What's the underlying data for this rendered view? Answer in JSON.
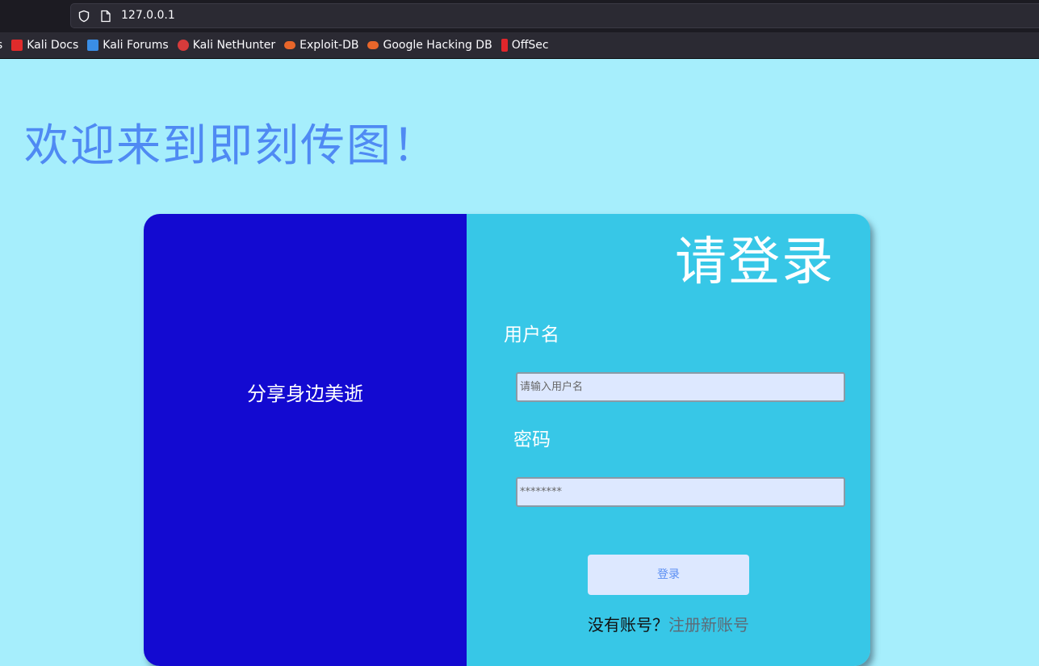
{
  "browser": {
    "url": "127.0.0.1",
    "bookmarks": [
      {
        "label": "ls",
        "icon": "truncated-bookmark",
        "color": ""
      },
      {
        "label": "Kali Docs",
        "icon": "kali-docs-icon",
        "color": "#e02b2b"
      },
      {
        "label": "Kali Forums",
        "icon": "kali-forums-icon",
        "color": "#3a8ee6"
      },
      {
        "label": "Kali NetHunter",
        "icon": "kali-nethunter-icon",
        "color": "#d63b3b"
      },
      {
        "label": "Exploit-DB",
        "icon": "exploit-db-icon",
        "color": "#e8662a"
      },
      {
        "label": "Google Hacking DB",
        "icon": "ghdb-icon",
        "color": "#e8662a"
      },
      {
        "label": "OffSec",
        "icon": "offsec-icon",
        "color": "#e0262b"
      }
    ]
  },
  "page": {
    "welcome": "欢迎来到即刻传图！",
    "slogan": "分享身边美逝",
    "login_title": "请登录",
    "username_label": "用户名",
    "username_placeholder": "请输入用户名",
    "password_label": "密码",
    "password_placeholder": "********",
    "submit_label": "登录",
    "no_account_text": "没有账号？",
    "register_link": "注册新账号"
  },
  "colors": {
    "page_bg": "#a6eefc",
    "left_panel": "#130ad1",
    "right_panel": "#37c7e7",
    "welcome_text": "#4f8af3",
    "field_bg": "#dde8ff"
  }
}
